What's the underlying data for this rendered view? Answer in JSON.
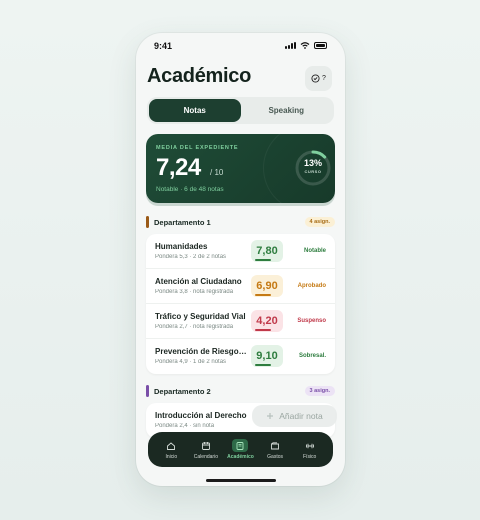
{
  "status": {
    "time": "9:41"
  },
  "header": {
    "title": "Académico",
    "help_label": "?"
  },
  "segments": [
    {
      "label": "Notas",
      "active": true
    },
    {
      "label": "Speaking",
      "active": false
    }
  ],
  "hero": {
    "label": "MEDIA DEL EXPEDIENTE",
    "score": "7,24",
    "max": "/ 10",
    "sub": "Notable · 6 de 48 notas",
    "pct": "13%",
    "pct_label": "CURSO",
    "pct_value": 0.13
  },
  "departments": [
    {
      "name": "Departamento 1",
      "badge": "4 asign.",
      "color": "#9a5a17",
      "rows": [
        {
          "name": "Humanidades",
          "sub": "Pondera 5,3 · 2 de 2 notas",
          "grade": "7,80",
          "status": "Notable",
          "tone": "green"
        },
        {
          "name": "Atención al Ciudadano",
          "sub": "Pondera 3,8 · nota registrada",
          "grade": "6,90",
          "status": "Aprobado",
          "tone": "amber"
        },
        {
          "name": "Tráfico y Seguridad Vial",
          "sub": "Pondera 2,7 · nota registrada",
          "grade": "4,20",
          "status": "Suspenso",
          "tone": "red"
        },
        {
          "name": "Prevención de Riesgos Laborales",
          "sub": "Pondera 4,9 · 1 de 2 notas",
          "grade": "9,10",
          "status": "Sobresal.",
          "tone": "green"
        }
      ]
    },
    {
      "name": "Departamento 2",
      "badge": "3 asign.",
      "color": "#7a4fa8",
      "rows": [
        {
          "name": "Introducción al Derecho",
          "sub": "Pondera 2,4 · sin nota",
          "grade": "",
          "status": "",
          "tone": "none"
        }
      ]
    }
  ],
  "fab": {
    "icon": "plus-icon",
    "label": "Añadir nota"
  },
  "tabs": [
    {
      "label": "Inicio",
      "icon": "home-icon",
      "active": false
    },
    {
      "label": "Calendario",
      "icon": "calendar-icon",
      "active": false
    },
    {
      "label": "Académico",
      "icon": "book-icon",
      "active": true
    },
    {
      "label": "Gastos",
      "icon": "wallet-icon",
      "active": false
    },
    {
      "label": "Físico",
      "icon": "dumbbell-icon",
      "active": false
    }
  ],
  "colors": {
    "accent": "#1d3f30",
    "green": "#2e7d3f",
    "amber": "#c57a14",
    "red": "#c0394a"
  }
}
